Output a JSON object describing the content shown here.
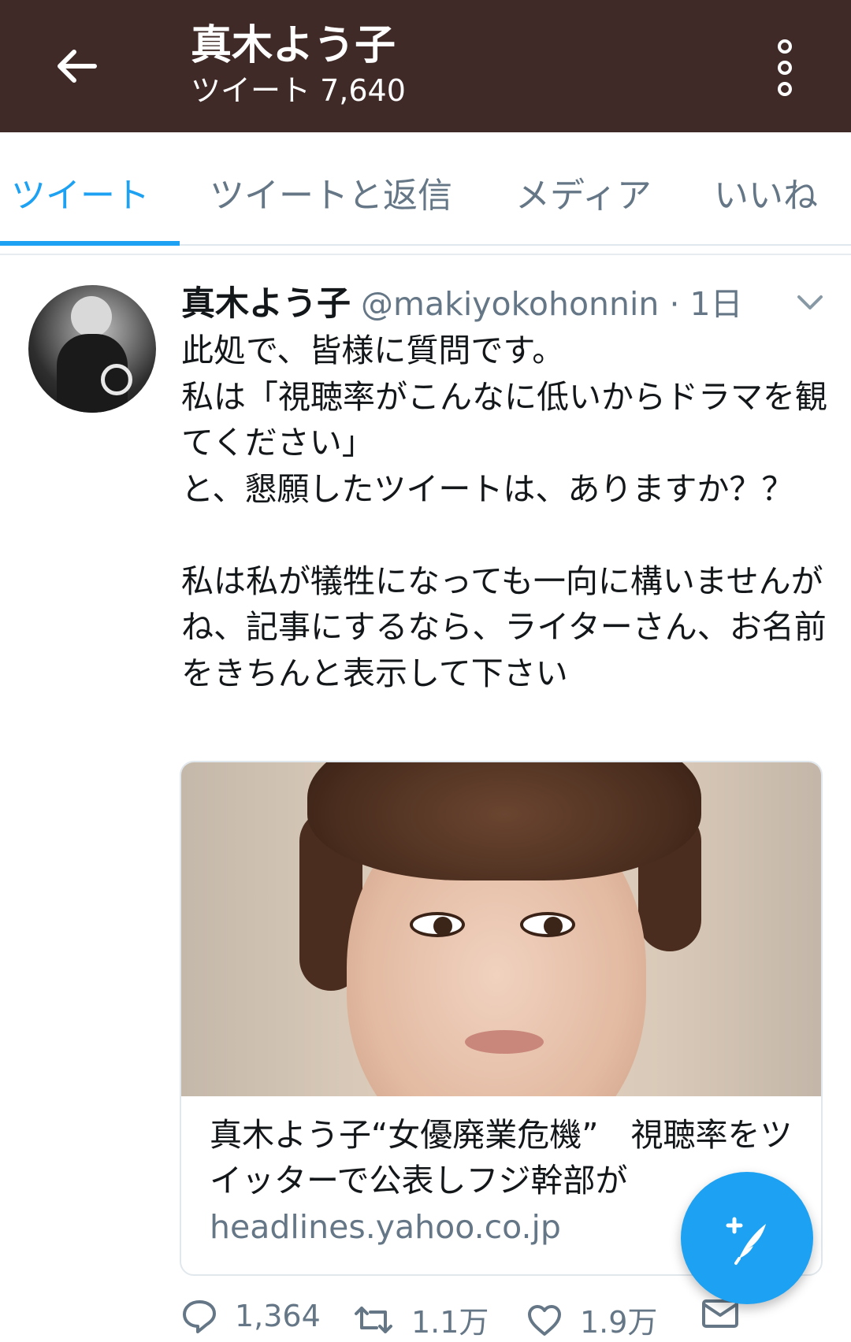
{
  "header": {
    "title": "真木よう子",
    "subtitle": "ツイート 7,640",
    "back_icon": "arrow-left-icon",
    "more_icon": "more-vertical-icon",
    "background_color": "#3f2a27"
  },
  "tabs": [
    {
      "label": "ツイート",
      "active": true
    },
    {
      "label": "ツイートと返信",
      "active": false
    },
    {
      "label": "メディア",
      "active": false
    },
    {
      "label": "いいね",
      "active": false
    }
  ],
  "tweet": {
    "name": "真木よう子",
    "handle": "@makiyokohonnin",
    "separator": "·",
    "time": "1日",
    "text": "此処で、皆様に質問です。\n私は「視聴率がこんなに低いからドラマを観てください」\nと、懇願したツイートは、ありますか？？\n\n私は私が犠牲になっても一向に構いませんがね、記事にするなら、ライターさん、お名前をきちんと表示して下さい",
    "card": {
      "title": "真木よう子“女優廃業危機”　視聴率をツイッターで公表しフジ幹部が",
      "domain": "headlines.yahoo.co.jp"
    },
    "actions": {
      "reply_count": "1,364",
      "retweet_count": "1.1万",
      "like_count": "1.9万"
    }
  },
  "accent_color": "#1da1f2",
  "fab_icon": "compose-tweet-icon"
}
